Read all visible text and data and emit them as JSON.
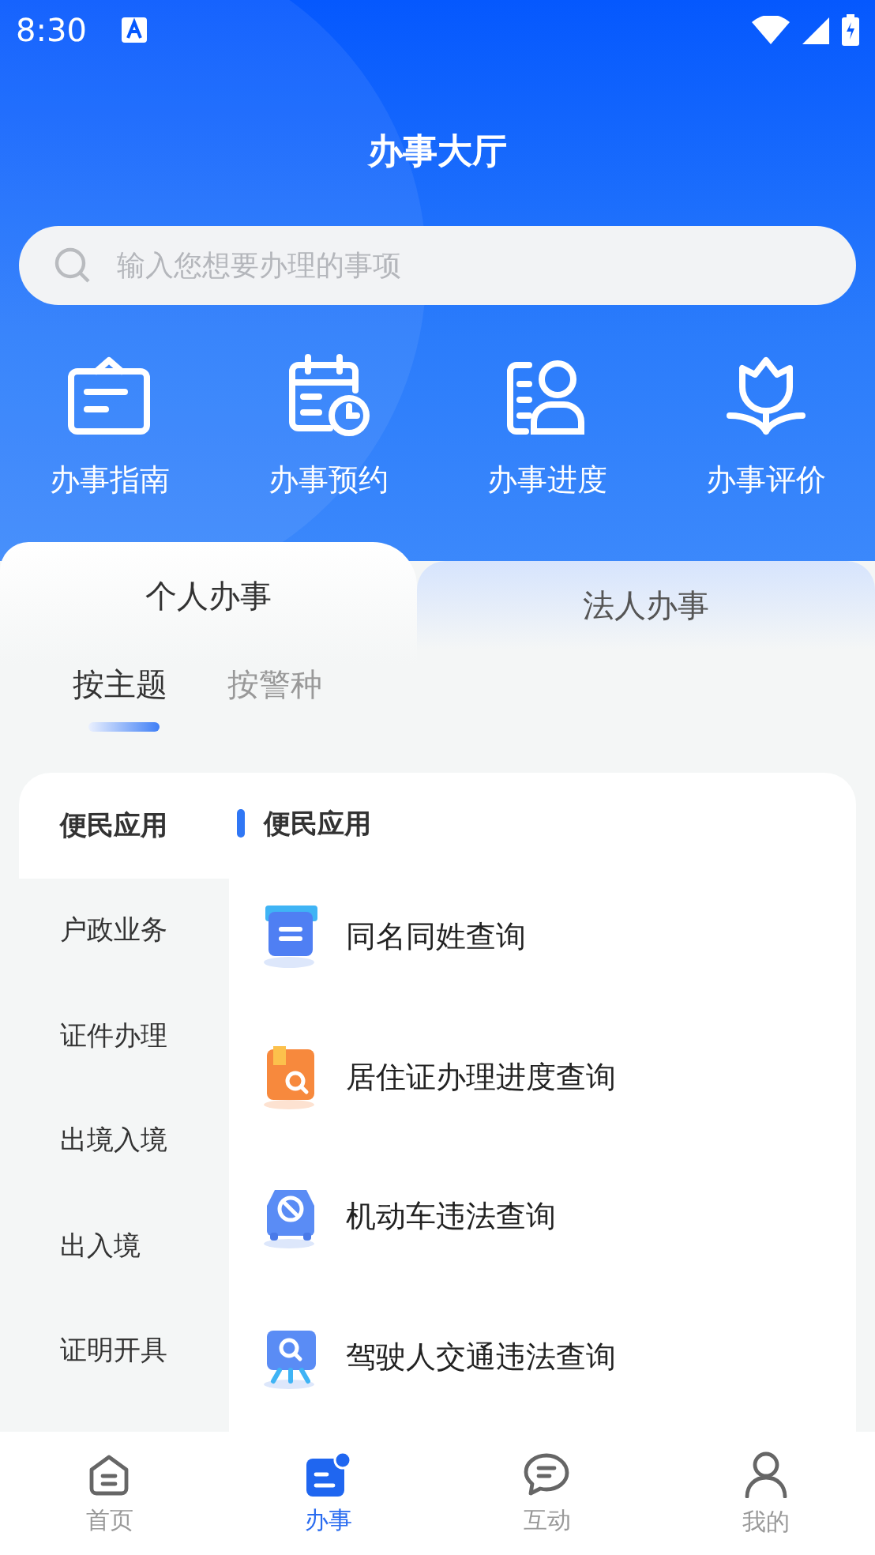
{
  "status_bar": {
    "time": "8:30"
  },
  "header": {
    "title": "办事大厅"
  },
  "search": {
    "placeholder": "输入您想要办理的事项"
  },
  "quick_actions": [
    {
      "label": "办事指南"
    },
    {
      "label": "办事预约"
    },
    {
      "label": "办事进度"
    },
    {
      "label": "办事评价"
    }
  ],
  "tabs": [
    {
      "label": "个人办事",
      "selected": true
    },
    {
      "label": "法人办事",
      "selected": false
    }
  ],
  "subtabs": [
    {
      "label": "按主题",
      "selected": true
    },
    {
      "label": "按警种",
      "selected": false
    }
  ],
  "categories": [
    {
      "label": "便民应用",
      "selected": true
    },
    {
      "label": "户政业务",
      "selected": false
    },
    {
      "label": "证件办理",
      "selected": false
    },
    {
      "label": "出境入境",
      "selected": false
    },
    {
      "label": "出入境",
      "selected": false
    },
    {
      "label": "证明开具",
      "selected": false
    }
  ],
  "section": {
    "title": "便民应用",
    "items": [
      {
        "label": "同名同姓查询"
      },
      {
        "label": "居住证办理进度查询"
      },
      {
        "label": "机动车违法查询"
      },
      {
        "label": "驾驶人交通违法查询"
      }
    ]
  },
  "bottom_nav": [
    {
      "label": "首页",
      "selected": false
    },
    {
      "label": "办事",
      "selected": true
    },
    {
      "label": "互动",
      "selected": false
    },
    {
      "label": "我的",
      "selected": false
    }
  ]
}
